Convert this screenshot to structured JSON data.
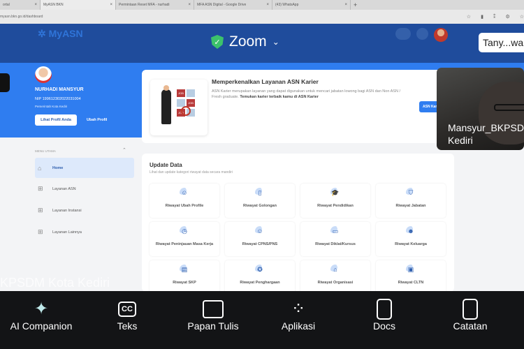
{
  "browser": {
    "tabs": [
      {
        "label": "ortal",
        "active": false
      },
      {
        "label": "MyASN BKN",
        "active": true
      },
      {
        "label": "Permintaan Reset MFA - nurhadi",
        "active": false
      },
      {
        "label": "MFA ASN Digital - Google Drive",
        "active": false
      },
      {
        "label": "(43) WhatsApp",
        "active": false
      }
    ],
    "new_tab": "+",
    "url": "myasn.bkn.go.id/dashboard"
  },
  "zoom": {
    "meeting_label": "Zoom",
    "ask_button": "Tany...wal",
    "accent": "#3cc26b"
  },
  "header": {
    "logo": "MyASN",
    "color": "#1f4c9c"
  },
  "profile": {
    "name": "NURHADI MANSYUR",
    "nip": "NIP 199612302022031004",
    "instansi": "Pemerintah Kota Kediri",
    "view_button": "Lihat Profil Anda",
    "edit_button": "Ubah Profil"
  },
  "promo": {
    "title": "Memperkenalkan Layanan ASN Karier",
    "text": "ASN Karier merupakan layanan yang dapat digunakan untuk mencari jabatan lowong bagi ASN dan Non ASN / Fresh graduate. ",
    "bold_text": "Temukan karier terbaik kamu di ASN Karier",
    "button": "ASN Karier",
    "illustration_label": "JOB"
  },
  "menu": {
    "heading": "MENU UTAMA",
    "items": [
      {
        "label": "Home",
        "icon": "home-icon",
        "active": true
      },
      {
        "label": "Layanan ASN",
        "icon": "grid-icon",
        "active": false
      },
      {
        "label": "Layanan Instansi",
        "icon": "grid-icon",
        "active": false
      },
      {
        "label": "Layanan Lainnya",
        "icon": "grid-icon",
        "active": false
      }
    ]
  },
  "update": {
    "title": "Update Data",
    "subtitle": "Lihat dan update kategori riwayat data secara mandiri",
    "tiles": [
      {
        "label": "Riwayat Ubah Profile",
        "icon": "user-icon"
      },
      {
        "label": "Riwayat Golongan",
        "icon": "document-icon"
      },
      {
        "label": "Riwayat Pendidikan",
        "icon": "graduation-cap-icon"
      },
      {
        "label": "Riwayat Jabatan",
        "icon": "badge-icon"
      },
      {
        "label": "Riwayat Peninjauan Masa Kerja",
        "icon": "clock-icon"
      },
      {
        "label": "Riwayat CPNS/PNS",
        "icon": "user-icon"
      },
      {
        "label": "Riwayat Diklat/Kursus",
        "icon": "presentation-icon"
      },
      {
        "label": "Riwayat Keluarga",
        "icon": "family-icon"
      },
      {
        "label": "Riwayat SKP",
        "icon": "clipboard-icon"
      },
      {
        "label": "Riwayat Penghargaan",
        "icon": "award-icon"
      },
      {
        "label": "Riwayat Organisasi",
        "icon": "organization-icon"
      },
      {
        "label": "Riwayat CLTN",
        "icon": "briefcase-icon"
      }
    ]
  },
  "video": {
    "participant": "Mansyur_BKPSDM\nKediri"
  },
  "caption": "KPSDM Kota Kediri",
  "toolbar": [
    {
      "label": "AI Companion",
      "icon": "sparkle-icon"
    },
    {
      "label": "Teks",
      "icon": "cc-icon"
    },
    {
      "label": "Papan Tulis",
      "icon": "whiteboard-icon"
    },
    {
      "label": "Aplikasi",
      "icon": "apps-icon"
    },
    {
      "label": "Docs",
      "icon": "docs-icon"
    },
    {
      "label": "Catatan",
      "icon": "notes-icon"
    }
  ],
  "cc_glyph": "CC"
}
